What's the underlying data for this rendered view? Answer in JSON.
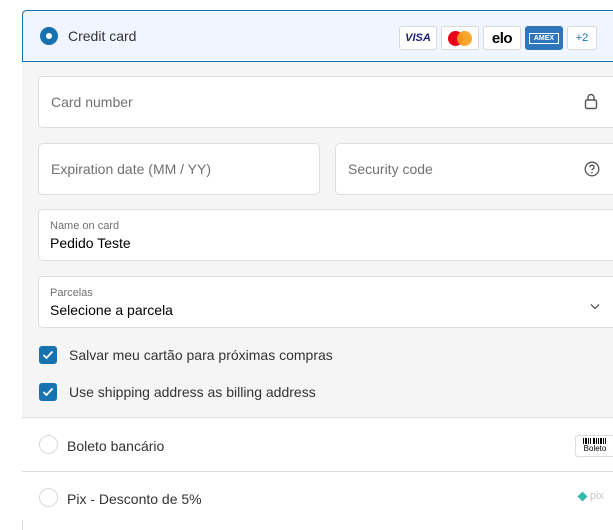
{
  "payment": {
    "credit_card": {
      "label": "Credit card",
      "brands": {
        "visa": "VISA",
        "elo": "elo",
        "amex": "AMEX",
        "more": "+2"
      },
      "accent_color": "#1773b0"
    },
    "card_form": {
      "card_number": {
        "placeholder": "Card number"
      },
      "expiration": {
        "placeholder": "Expiration date (MM / YY)"
      },
      "security_code": {
        "placeholder": "Security code"
      },
      "name_on_card": {
        "label": "Name on card",
        "value": "Pedido Teste"
      },
      "parcelas": {
        "label": "Parcelas",
        "value": "Selecione a parcela"
      },
      "save_card": {
        "label": "Salvar meu cartão para próximas compras",
        "checked": true
      },
      "billing_same": {
        "label": "Use shipping address as billing address",
        "checked": true
      }
    },
    "boleto": {
      "label": "Boleto bancário",
      "logo_text": "Boleto"
    },
    "pix": {
      "label": "Pix - Desconto de 5%",
      "logo_text": "pix"
    }
  }
}
